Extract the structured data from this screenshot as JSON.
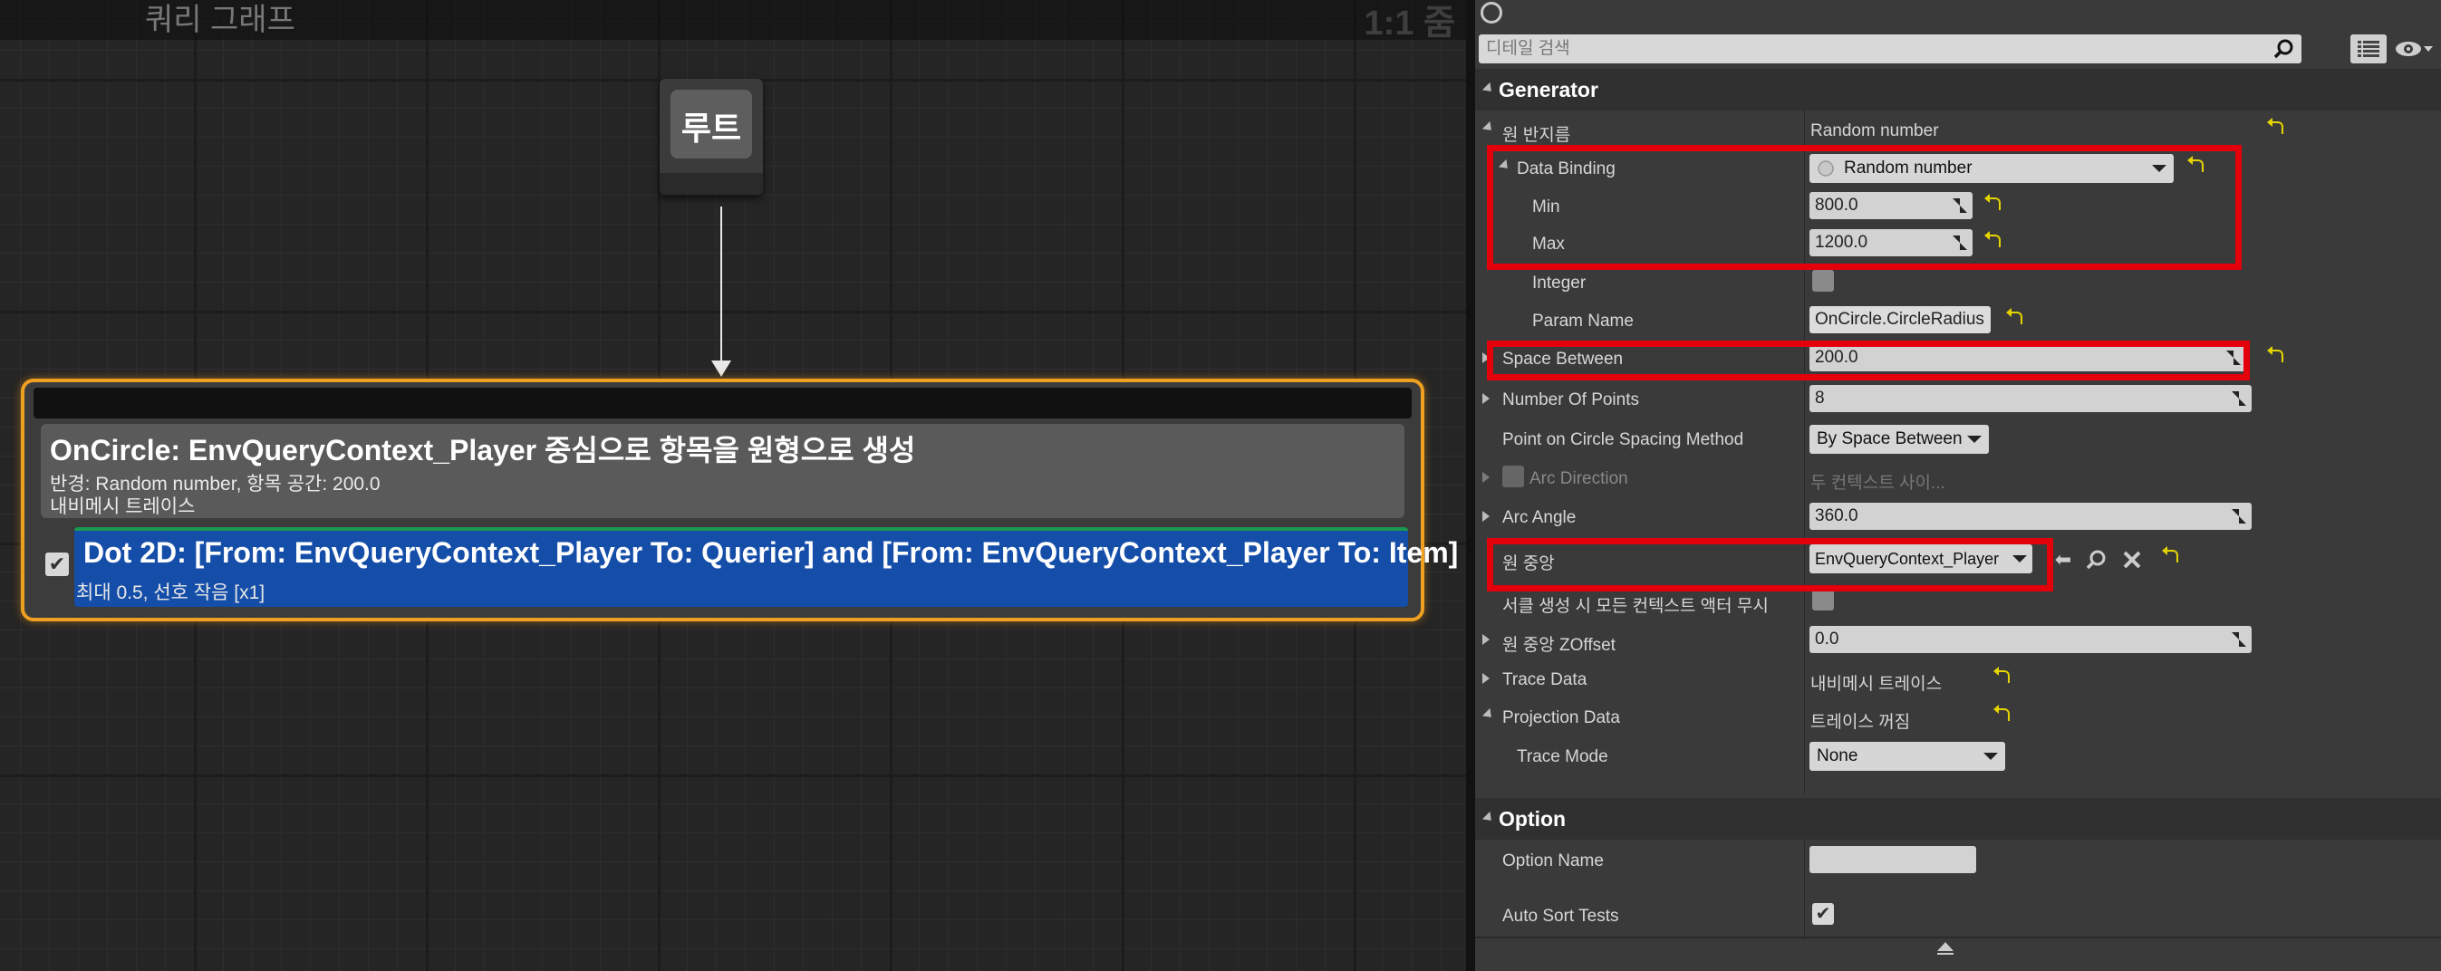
{
  "graph": {
    "title": "쿼리 그래프",
    "zoom": "1:1 줌",
    "root_label": "루트",
    "generator_title": "OnCircle: EnvQueryContext_Player 중심으로 항목을 원형으로 생성",
    "generator_sub1": "반경: Random number, 항목 공간: 200.0",
    "generator_sub2": "내비메시 트레이스",
    "test_title": "Dot 2D: [From: EnvQueryContext_Player To: Querier] and [From: EnvQueryContext_Player To: Item]",
    "test_sub": "최대 0.5, 선호 작음 [x1]",
    "test_enabled": true
  },
  "details": {
    "search_placeholder": "디테일 검색",
    "generator_category": "Generator",
    "option_category": "Option",
    "rows": {
      "circle_radius": {
        "name": "원 반지름",
        "value": "Random number"
      },
      "data_binding": {
        "name": "Data Binding",
        "value": "Random number"
      },
      "min": {
        "name": "Min",
        "value": "800.0"
      },
      "max": {
        "name": "Max",
        "value": "1200.0"
      },
      "integer": {
        "name": "Integer"
      },
      "param_name": {
        "name": "Param Name",
        "value": "OnCircle.CircleRadius"
      },
      "space_between": {
        "name": "Space Between",
        "value": "200.0"
      },
      "number_of_points": {
        "name": "Number Of Points",
        "value": "8"
      },
      "spacing_method": {
        "name": "Point on Circle Spacing Method",
        "value": "By Space Between"
      },
      "arc_direction": {
        "name": "Arc Direction",
        "value": "두 컨텍스트 사이..."
      },
      "arc_angle": {
        "name": "Arc Angle",
        "value": "360.0"
      },
      "circle_center": {
        "name": "원 중앙",
        "value": "EnvQueryContext_Player"
      },
      "ignore_context_actors": {
        "name": "서클 생성 시 모든 컨텍스트 액터 무시"
      },
      "center_zoffset": {
        "name": "원 중앙 ZOffset",
        "value": "0.0"
      },
      "trace_data": {
        "name": "Trace Data",
        "value": "내비메시 트레이스"
      },
      "projection_data": {
        "name": "Projection Data",
        "value": "트레이스 꺼짐"
      },
      "trace_mode": {
        "name": "Trace Mode",
        "value": "None"
      },
      "option_name": {
        "name": "Option Name",
        "value": ""
      },
      "auto_sort_tests": {
        "name": "Auto Sort Tests"
      }
    }
  },
  "colors": {
    "highlight": "#e3000b",
    "node_border": "#f0a020",
    "test_background": "#154ea8",
    "reset_arrow": "#e6d400"
  }
}
